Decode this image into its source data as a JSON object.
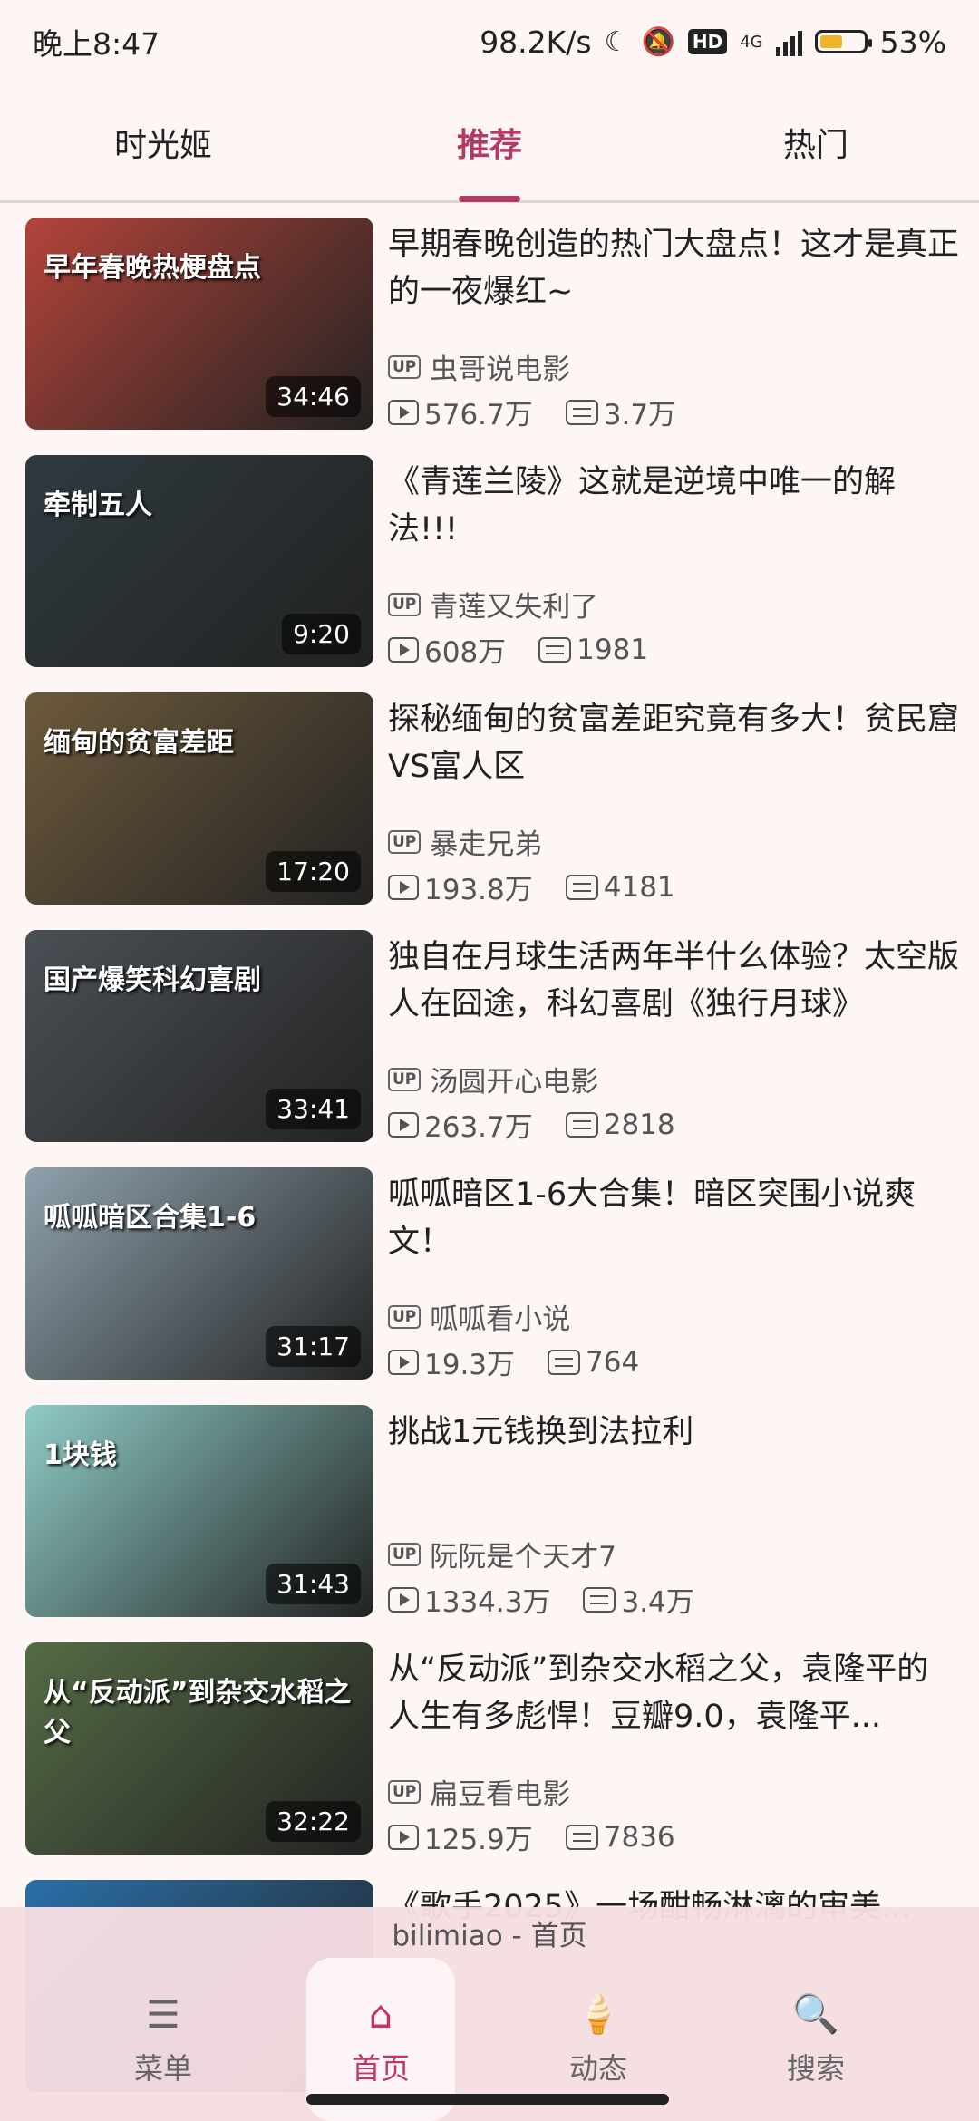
{
  "status": {
    "time": "晚上8:47",
    "speed": "98.2K/s",
    "hd": "HD",
    "net": "4G",
    "battery": "53%",
    "battery_level": 0.53
  },
  "tabs": [
    {
      "label": "时光姬"
    },
    {
      "label": "推荐"
    },
    {
      "label": "热门"
    }
  ],
  "videos": [
    {
      "title": "早期春晚创造的热门大盘点！这才是真正的一夜爆红~",
      "up": "虫哥说电影",
      "plays": "576.7万",
      "danmaku": "3.7万",
      "duration": "34:46",
      "thumb_text": "早年春晚热梗盘点",
      "thumb_color": "#b3443a"
    },
    {
      "title": "《青莲兰陵》这就是逆境中唯一的解法!!!",
      "up": "青莲又失利了",
      "plays": "608万",
      "danmaku": "1981",
      "duration": "9:20",
      "thumb_text": "牵制五人",
      "thumb_color": "#2f3a3f"
    },
    {
      "title": "探秘缅甸的贫富差距究竟有多大！贫民窟VS富人区",
      "up": "暴走兄弟",
      "plays": "193.8万",
      "danmaku": "4181",
      "duration": "17:20",
      "thumb_text": "缅甸的贫富差距",
      "thumb_color": "#6d5a3c"
    },
    {
      "title": "独自在月球生活两年半什么体验？太空版人在囧途，科幻喜剧《独行月球》",
      "up": "汤圆开心电影",
      "plays": "263.7万",
      "danmaku": "2818",
      "duration": "33:41",
      "thumb_text": "国产爆笑科幻喜剧",
      "thumb_color": "#4b5056"
    },
    {
      "title": "呱呱暗区1-6大合集！暗区突围小说爽文！",
      "up": "呱呱看小说",
      "plays": "19.3万",
      "danmaku": "764",
      "duration": "31:17",
      "thumb_text": "呱呱暗区合集1-6",
      "thumb_color": "#8ea1ad"
    },
    {
      "title": "挑战1元钱换到法拉利",
      "up": "阮阮是个天才7",
      "plays": "1334.3万",
      "danmaku": "3.4万",
      "duration": "31:43",
      "thumb_text": "1块钱",
      "thumb_color": "#8fcbc6"
    },
    {
      "title": "从“反动派”到杂交水稻之父，袁隆平的人生有多彪悍！豆瓣9.0，袁隆平...",
      "up": "扁豆看电影",
      "plays": "125.9万",
      "danmaku": "7836",
      "duration": "32:22",
      "thumb_text": "从“反动派”到杂交水稻之父",
      "thumb_color": "#556b45"
    },
    {
      "title": "《歌手2025》一场酣畅淋漓的审美...",
      "up": "",
      "plays": "",
      "danmaku": "",
      "duration": "",
      "thumb_text": "",
      "thumb_color": "#2a6fa8"
    }
  ],
  "bottom": {
    "title": "bilimiao - 首页",
    "nav": [
      {
        "label": "菜单",
        "icon": "menu-icon"
      },
      {
        "label": "首页",
        "icon": "home-icon"
      },
      {
        "label": "动态",
        "icon": "icecream-icon"
      },
      {
        "label": "搜索",
        "icon": "search-icon"
      }
    ]
  }
}
